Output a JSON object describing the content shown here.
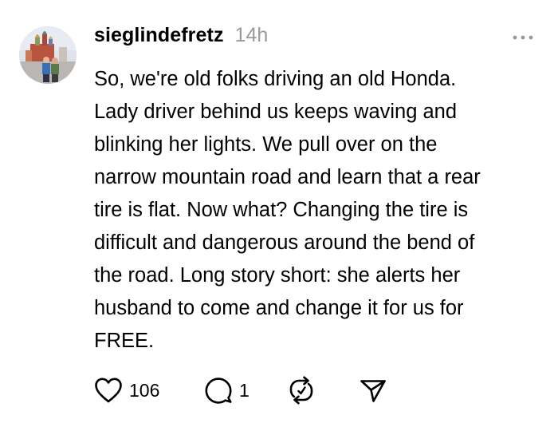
{
  "post": {
    "username": "sieglindefretz",
    "time": "14h",
    "lines": [
      "So, we're old folks driving an old Honda.",
      "Lady driver behind us keeps waving and",
      "blinking her lights. We pull over on the",
      "narrow mountain road and learn that a rear",
      "tire is flat. Now what? Changing the tire is",
      "difficult and dangerous around the bend of",
      "the road. Long story short: she alerts her",
      "husband to come and change it for us for",
      "FREE."
    ],
    "like_count": "106",
    "reply_count": "1"
  },
  "icons": {
    "avatar": "profile-photo",
    "more": "more-horizontal-icon",
    "like": "heart-icon",
    "reply": "comment-bubble-icon",
    "repost": "repost-icon",
    "share": "send-icon"
  },
  "colors": {
    "text": "#000000",
    "muted": "#999999",
    "background": "#ffffff"
  }
}
